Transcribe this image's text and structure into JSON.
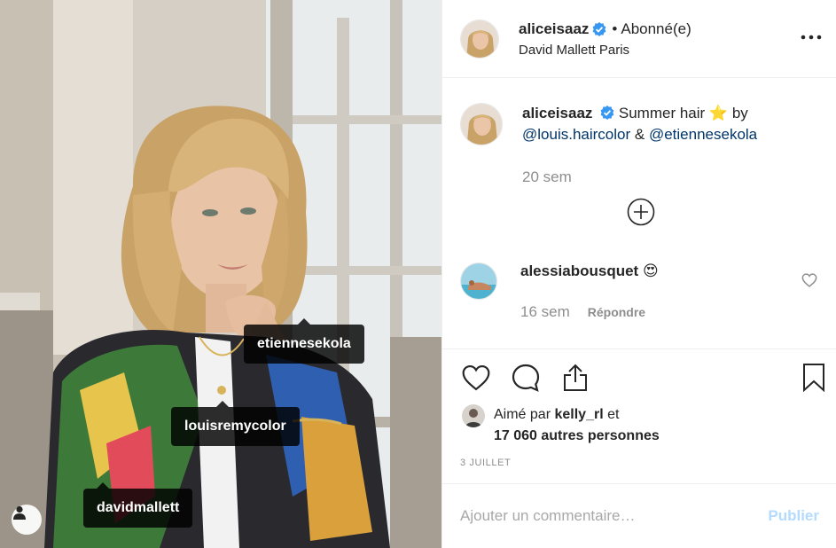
{
  "post": {
    "tags": [
      {
        "label": "etiennesekola"
      },
      {
        "label": "louisremycolor"
      },
      {
        "label": "davidmallett"
      }
    ]
  },
  "header": {
    "username": "aliceisaaz",
    "separator": "•",
    "follow_state": "Abonné(e)",
    "location": "David Mallett Paris",
    "more_icon": "more-horizontal-icon"
  },
  "caption": {
    "username": "aliceisaaz",
    "text_before": "Summer hair",
    "emoji": "⭐",
    "text_by": "by",
    "mention1": "@louis.haircolor",
    "amp": "&",
    "mention2": "@etiennesekola",
    "time": "20 sem"
  },
  "comment": {
    "username": "alessiabousquet",
    "emoji": "😍",
    "time": "16 sem",
    "reply_label": "Répondre"
  },
  "likes": {
    "prefix": "Aimé par",
    "user": "kelly_rl",
    "and": "et",
    "others": "17 060 autres personnes"
  },
  "date": "3 JUILLET",
  "add_comment": {
    "placeholder": "Ajouter un commentaire…",
    "publish_label": "Publier"
  },
  "colors": {
    "verified": "#3897f0",
    "mention": "#003569",
    "muted": "#8e8e8e",
    "publish_disabled": "#b3dbff"
  }
}
